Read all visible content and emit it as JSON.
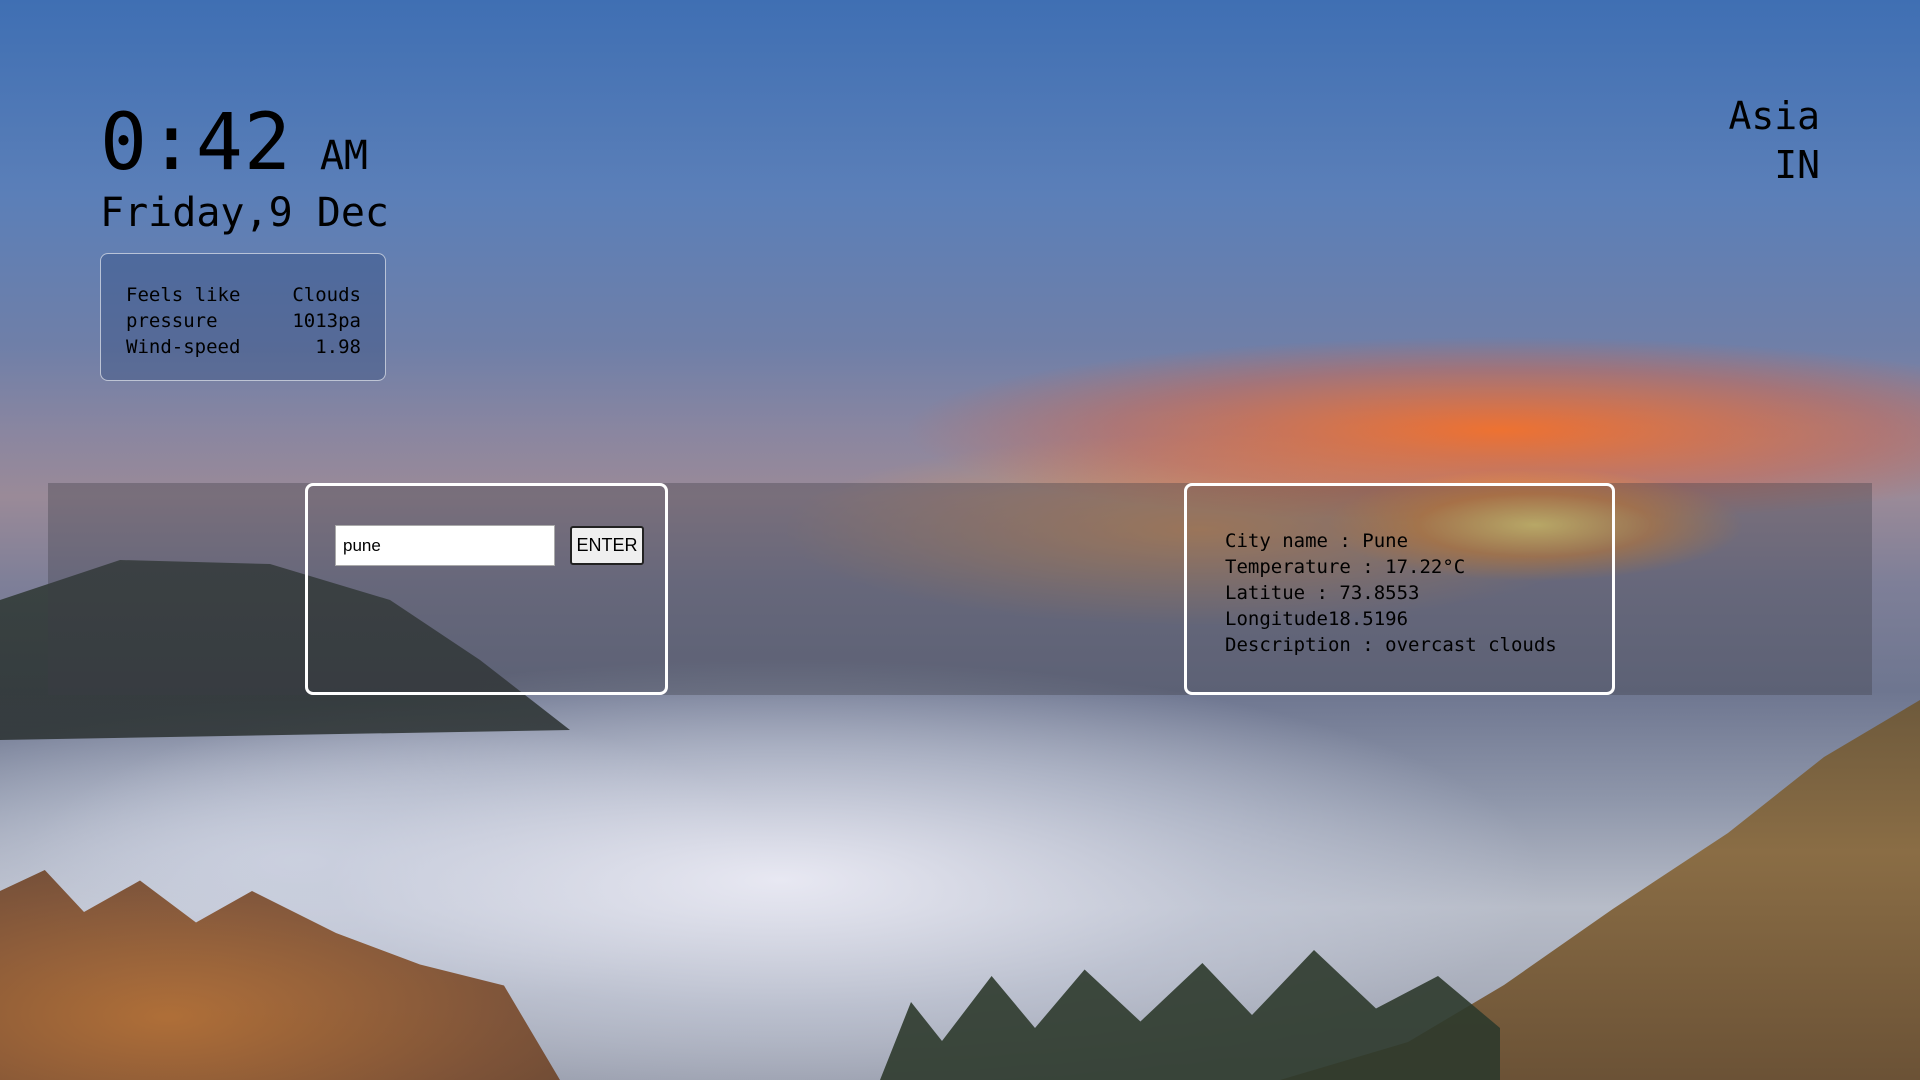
{
  "clock": {
    "time": "0:42",
    "ampm": "AM",
    "date": "Friday,9 Dec"
  },
  "region": {
    "continent": "Asia",
    "country": "IN"
  },
  "summary": {
    "rows": [
      {
        "label": "Feels like",
        "value": "Clouds"
      },
      {
        "label": "pressure",
        "value": "1013pa"
      },
      {
        "label": "Wind-speed",
        "value": "1.98"
      }
    ]
  },
  "search": {
    "value": "pune",
    "button_label": "ENTER"
  },
  "result": {
    "lines": [
      "City name : Pune",
      "Temperature : 17.22°C",
      "Latitue : 73.8553",
      "Longitude18.5196",
      "Description : overcast clouds"
    ]
  }
}
